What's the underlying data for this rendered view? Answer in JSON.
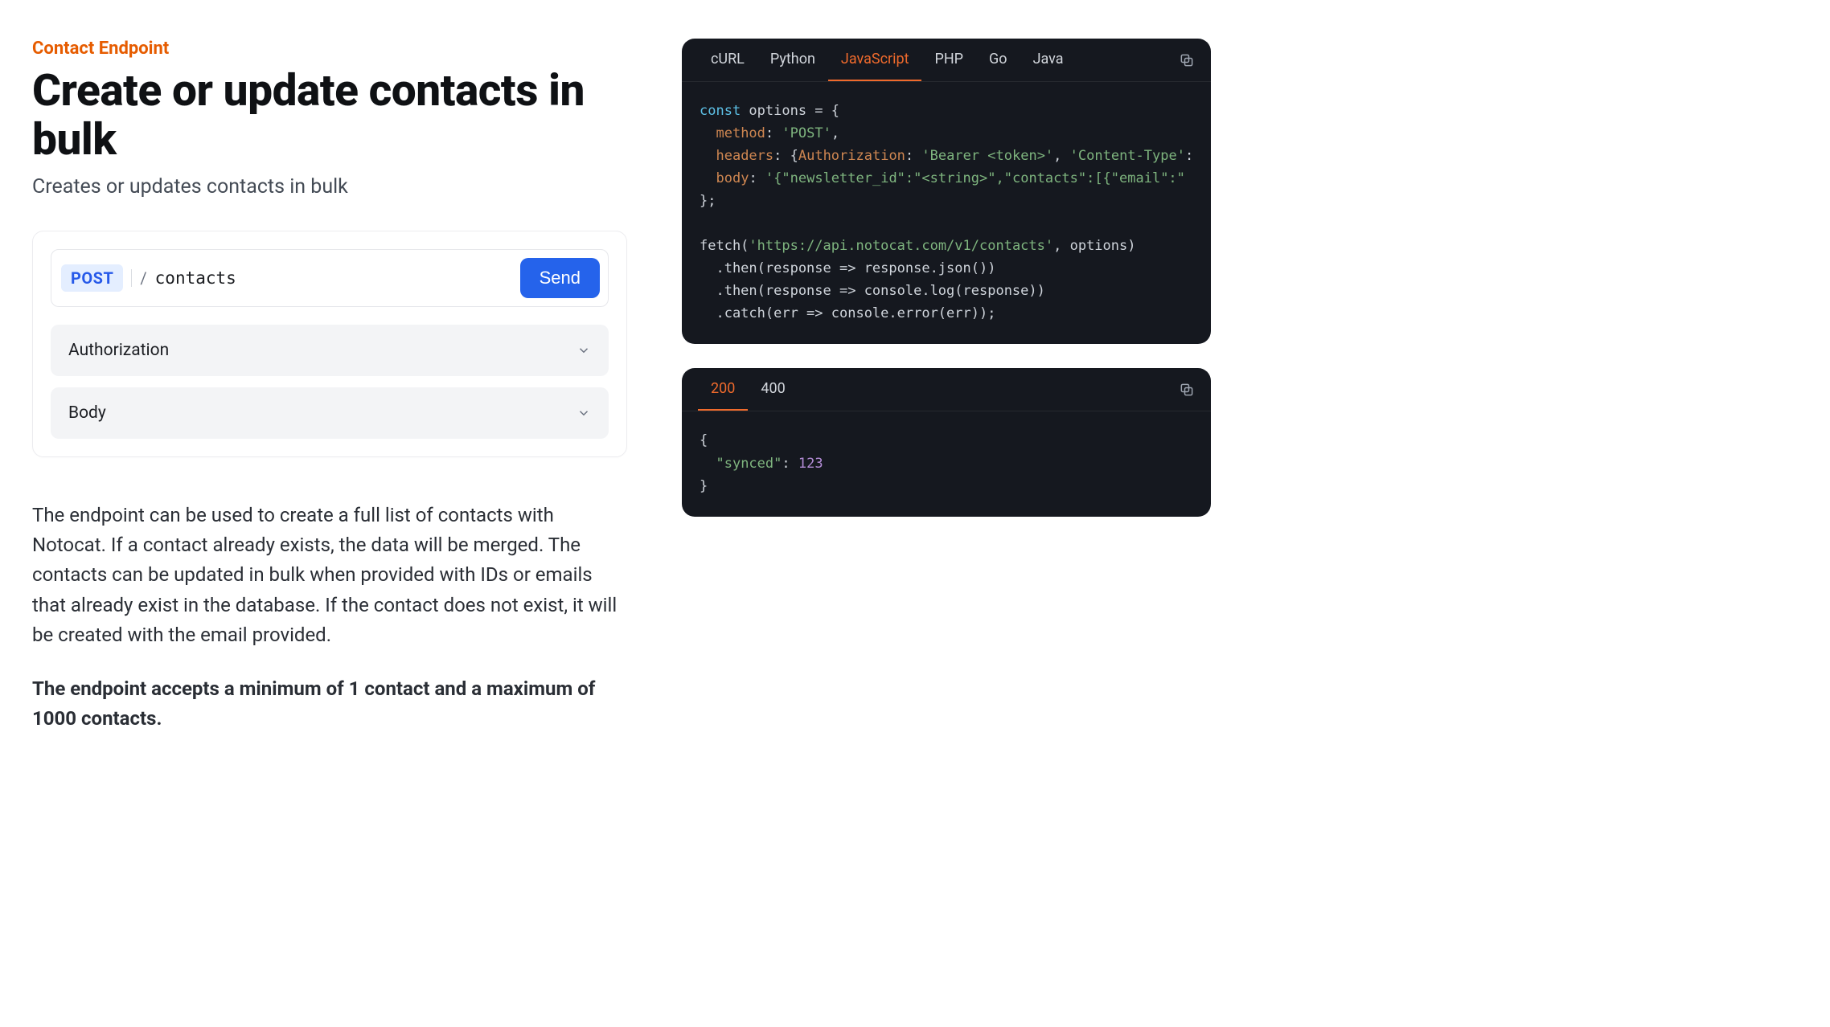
{
  "category": "Contact Endpoint",
  "title": "Create or update contacts in bulk",
  "subtitle": "Creates or updates contacts in bulk",
  "request": {
    "method": "POST",
    "slash": "/",
    "path": "contacts",
    "send_label": "Send",
    "sections": [
      {
        "label": "Authorization"
      },
      {
        "label": "Body"
      }
    ]
  },
  "description_paragraphs": [
    "The endpoint can be used to create a full list of contacts with Notocat. If a contact already exists, the data will be merged. The contacts can be updated in bulk when provided with IDs or emails that already exist in the database. If the contact does not exist, it will be created with the email provided.",
    "The endpoint accepts a minimum of 1 contact and a maximum of 1000 contacts."
  ],
  "code_panel": {
    "tabs": [
      "cURL",
      "Python",
      "JavaScript",
      "PHP",
      "Go",
      "Java"
    ],
    "active_tab": "JavaScript",
    "code_tokens": [
      [
        [
          "kw",
          "const"
        ],
        [
          "plain",
          " options = {"
        ]
      ],
      [
        [
          "plain",
          "  "
        ],
        [
          "key",
          "method"
        ],
        [
          "plain",
          ": "
        ],
        [
          "str",
          "'POST'"
        ],
        [
          "plain",
          ","
        ]
      ],
      [
        [
          "plain",
          "  "
        ],
        [
          "key",
          "headers"
        ],
        [
          "plain",
          ": {"
        ],
        [
          "key",
          "Authorization"
        ],
        [
          "plain",
          ": "
        ],
        [
          "str",
          "'Bearer <token>'"
        ],
        [
          "plain",
          ", "
        ],
        [
          "str",
          "'Content-Type'"
        ],
        [
          "plain",
          ":"
        ]
      ],
      [
        [
          "plain",
          "  "
        ],
        [
          "key",
          "body"
        ],
        [
          "plain",
          ": "
        ],
        [
          "str",
          "'{\"newsletter_id\":\"<string>\",\"contacts\":[{\"email\":\""
        ]
      ],
      [
        [
          "plain",
          "};"
        ]
      ],
      [
        [
          "plain",
          ""
        ]
      ],
      [
        [
          "plain",
          "fetch("
        ],
        [
          "str",
          "'https://api.notocat.com/v1/contacts'"
        ],
        [
          "plain",
          ", options)"
        ]
      ],
      [
        [
          "plain",
          "  .then(response => response.json())"
        ]
      ],
      [
        [
          "plain",
          "  .then(response => console.log(response))"
        ]
      ],
      [
        [
          "plain",
          "  .catch(err => console.error(err));"
        ]
      ]
    ]
  },
  "response_panel": {
    "tabs": [
      "200",
      "400"
    ],
    "active_tab": "200",
    "code_tokens": [
      [
        [
          "plain",
          "{"
        ]
      ],
      [
        [
          "plain",
          "  "
        ],
        [
          "str",
          "\"synced\""
        ],
        [
          "plain",
          ": "
        ],
        [
          "num",
          "123"
        ]
      ],
      [
        [
          "plain",
          "}"
        ]
      ]
    ]
  }
}
